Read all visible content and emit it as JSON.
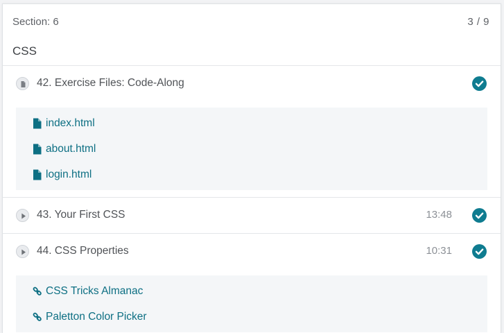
{
  "section": {
    "label": "Section: 6",
    "progress": "3 / 9",
    "title": "CSS"
  },
  "lectures": [
    {
      "title": "42. Exercise Files: Code-Along",
      "duration": "",
      "type_icon": "file-icon",
      "completed": true,
      "resources": [
        {
          "label": "index.html",
          "icon": "file-icon"
        },
        {
          "label": "about.html",
          "icon": "file-icon"
        },
        {
          "label": "login.html",
          "icon": "file-icon"
        }
      ]
    },
    {
      "title": "43. Your First CSS",
      "duration": "13:48",
      "type_icon": "play-icon",
      "completed": true,
      "resources": []
    },
    {
      "title": "44. CSS Properties",
      "duration": "10:31",
      "type_icon": "play-icon",
      "completed": true,
      "resources": [
        {
          "label": "CSS Tricks Almanac",
          "icon": "link-icon"
        },
        {
          "label": "Paletton Color Picker",
          "icon": "link-icon"
        }
      ]
    }
  ],
  "colors": {
    "accent": "#0f7c90",
    "link": "#0d6f83",
    "resource_bg": "#f4f6f8"
  }
}
